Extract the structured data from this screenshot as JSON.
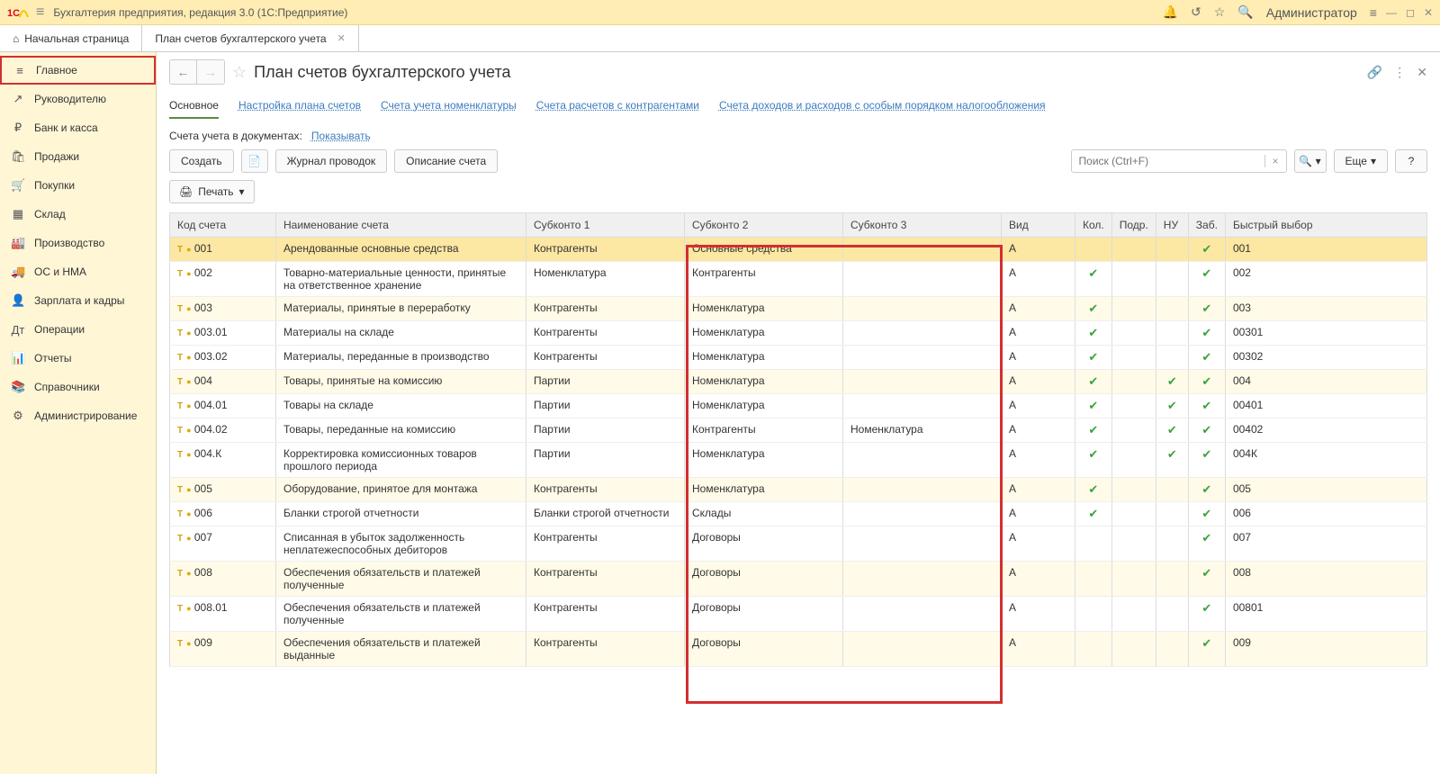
{
  "titlebar": {
    "app_title": "Бухгалтерия предприятия, редакция 3.0  (1С:Предприятие)",
    "user": "Администратор"
  },
  "tabs": {
    "home": "Начальная страница",
    "current": "План счетов бухгалтерского учета"
  },
  "sidebar": [
    {
      "icon": "≡",
      "label": "Главное"
    },
    {
      "icon": "↗",
      "label": "Руководителю"
    },
    {
      "icon": "₽",
      "label": "Банк и касса"
    },
    {
      "icon": "🛍",
      "label": "Продажи"
    },
    {
      "icon": "🛒",
      "label": "Покупки"
    },
    {
      "icon": "▦",
      "label": "Склад"
    },
    {
      "icon": "🏭",
      "label": "Производство"
    },
    {
      "icon": "🚚",
      "label": "ОС и НМА"
    },
    {
      "icon": "👤",
      "label": "Зарплата и кадры"
    },
    {
      "icon": "Дт",
      "label": "Операции"
    },
    {
      "icon": "📊",
      "label": "Отчеты"
    },
    {
      "icon": "📚",
      "label": "Справочники"
    },
    {
      "icon": "⚙",
      "label": "Администрирование"
    }
  ],
  "header": {
    "title": "План счетов бухгалтерского учета"
  },
  "subtabs": [
    "Основное",
    "Настройка плана счетов",
    "Счета учета номенклатуры",
    "Счета расчетов с контрагентами",
    "Счета доходов и расходов с особым порядком налогообложения"
  ],
  "info": {
    "label": "Счета учета в документах:",
    "link": "Показывать"
  },
  "toolbar": {
    "create": "Создать",
    "journal": "Журнал проводок",
    "describe": "Описание счета",
    "search_placeholder": "Поиск (Ctrl+F)",
    "more": "Еще",
    "print": "Печать"
  },
  "columns": [
    "Код счета",
    "Наименование счета",
    "Субконто 1",
    "Субконто 2",
    "Субконто 3",
    "Вид",
    "Кол.",
    "Подр.",
    "НУ",
    "Заб.",
    "Быстрый выбор"
  ],
  "rows": [
    {
      "code": "001",
      "name": "Арендованные основные средства",
      "s1": "Контрагенты",
      "s2": "Основные средства",
      "s3": "",
      "vid": "А",
      "kol": false,
      "podr": false,
      "nu": false,
      "zab": true,
      "fast": "001",
      "sel": true
    },
    {
      "code": "002",
      "name": "Товарно-материальные ценности, принятые на ответственное хранение",
      "s1": "Номенклатура",
      "s2": "Контрагенты",
      "s3": "",
      "vid": "А",
      "kol": true,
      "podr": false,
      "nu": false,
      "zab": true,
      "fast": "002"
    },
    {
      "code": "003",
      "name": "Материалы, принятые в переработку",
      "s1": "Контрагенты",
      "s2": "Номенклатура",
      "s3": "",
      "vid": "А",
      "kol": true,
      "podr": false,
      "nu": false,
      "zab": true,
      "fast": "003",
      "alt": true
    },
    {
      "code": "003.01",
      "name": "Материалы на складе",
      "s1": "Контрагенты",
      "s2": "Номенклатура",
      "s3": "",
      "vid": "А",
      "kol": true,
      "podr": false,
      "nu": false,
      "zab": true,
      "fast": "00301"
    },
    {
      "code": "003.02",
      "name": "Материалы, переданные в производство",
      "s1": "Контрагенты",
      "s2": "Номенклатура",
      "s3": "",
      "vid": "А",
      "kol": true,
      "podr": false,
      "nu": false,
      "zab": true,
      "fast": "00302"
    },
    {
      "code": "004",
      "name": "Товары, принятые на комиссию",
      "s1": "Партии",
      "s2": "Номенклатура",
      "s3": "",
      "vid": "А",
      "kol": true,
      "podr": false,
      "nu": true,
      "zab": true,
      "fast": "004",
      "alt": true
    },
    {
      "code": "004.01",
      "name": "Товары на складе",
      "s1": "Партии",
      "s2": "Номенклатура",
      "s3": "",
      "vid": "А",
      "kol": true,
      "podr": false,
      "nu": true,
      "zab": true,
      "fast": "00401"
    },
    {
      "code": "004.02",
      "name": "Товары, переданные на комиссию",
      "s1": "Партии",
      "s2": "Контрагенты",
      "s3": "Номенклатура",
      "vid": "А",
      "kol": true,
      "podr": false,
      "nu": true,
      "zab": true,
      "fast": "00402"
    },
    {
      "code": "004.К",
      "name": "Корректировка комиссионных товаров прошлого периода",
      "s1": "Партии",
      "s2": "Номенклатура",
      "s3": "",
      "vid": "А",
      "kol": true,
      "podr": false,
      "nu": true,
      "zab": true,
      "fast": "004К"
    },
    {
      "code": "005",
      "name": "Оборудование, принятое для монтажа",
      "s1": "Контрагенты",
      "s2": "Номенклатура",
      "s3": "",
      "vid": "А",
      "kol": true,
      "podr": false,
      "nu": false,
      "zab": true,
      "fast": "005",
      "alt": true
    },
    {
      "code": "006",
      "name": "Бланки строгой отчетности",
      "s1": "Бланки строгой отчетности",
      "s2": "Склады",
      "s3": "",
      "vid": "А",
      "kol": true,
      "podr": false,
      "nu": false,
      "zab": true,
      "fast": "006"
    },
    {
      "code": "007",
      "name": "Списанная в убыток задолженность неплатежеспособных дебиторов",
      "s1": "Контрагенты",
      "s2": "Договоры",
      "s3": "",
      "vid": "А",
      "kol": false,
      "podr": false,
      "nu": false,
      "zab": true,
      "fast": "007"
    },
    {
      "code": "008",
      "name": "Обеспечения обязательств и платежей полученные",
      "s1": "Контрагенты",
      "s2": "Договоры",
      "s3": "",
      "vid": "А",
      "kol": false,
      "podr": false,
      "nu": false,
      "zab": true,
      "fast": "008",
      "alt": true
    },
    {
      "code": "008.01",
      "name": "Обеспечения обязательств и платежей полученные",
      "s1": "Контрагенты",
      "s2": "Договоры",
      "s3": "",
      "vid": "А",
      "kol": false,
      "podr": false,
      "nu": false,
      "zab": true,
      "fast": "00801"
    },
    {
      "code": "009",
      "name": "Обеспечения обязательств и платежей выданные",
      "s1": "Контрагенты",
      "s2": "Договоры",
      "s3": "",
      "vid": "А",
      "kol": false,
      "podr": false,
      "nu": false,
      "zab": true,
      "fast": "009",
      "alt": true
    }
  ]
}
